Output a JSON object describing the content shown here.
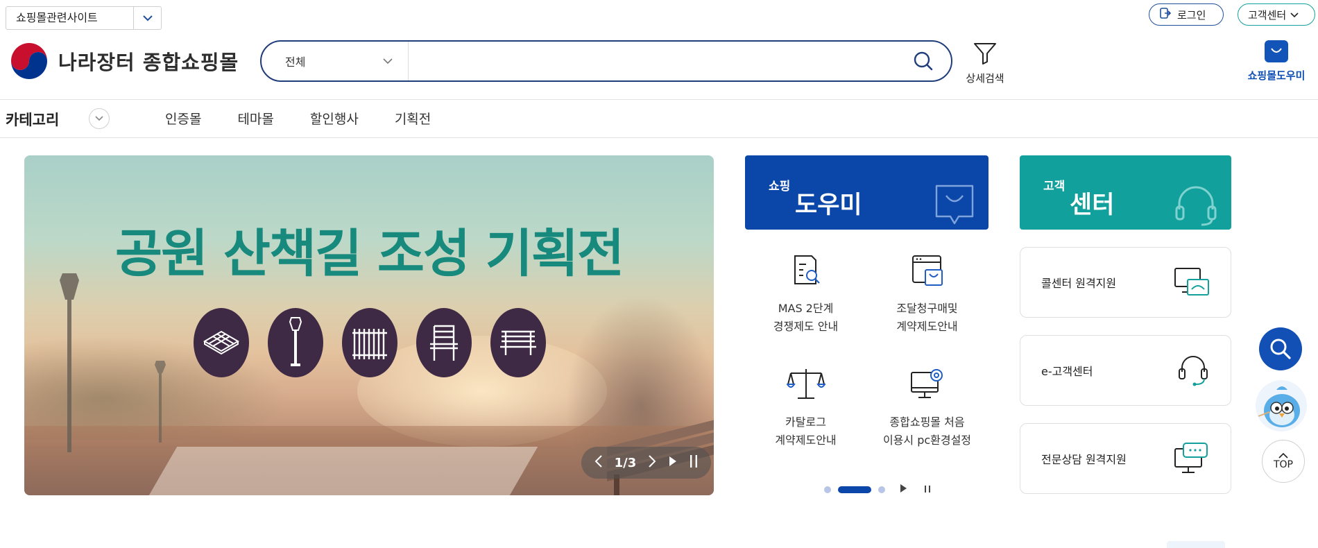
{
  "top_bar": {
    "site_select_label": "쇼핑몰관련사이트",
    "login_label": "로그인",
    "customer_center_label": "고객센터"
  },
  "header": {
    "logo_title": "나라장터 종합쇼핑몰",
    "search_scope": "전체",
    "search_value": "",
    "detail_search_label": "상세검색",
    "helper_label": "쇼핑몰도우미"
  },
  "nav": {
    "category_label": "카테고리",
    "items": [
      "인증몰",
      "테마몰",
      "할인행사",
      "기획전"
    ]
  },
  "banner": {
    "headline": "공원 산책길 조성 기획전",
    "pager": "1/3"
  },
  "shopping_helper": {
    "small_label": "쇼핑",
    "big_label": "도우미",
    "items": [
      {
        "line1": "MAS 2단계",
        "line2": "경쟁제도 안내",
        "icon": "document-search-icon"
      },
      {
        "line1": "조달청구매및",
        "line2": "계약제도안내",
        "icon": "browser-cart-icon"
      },
      {
        "line1": "카탈로그",
        "line2": "계약제도안내",
        "icon": "scale-icon"
      },
      {
        "line1": "종합쇼핑몰 처음",
        "line2": "이용시 pc환경설정",
        "icon": "monitor-gear-icon"
      }
    ]
  },
  "customer_center": {
    "small_label": "고객",
    "big_label": "센터",
    "cards": [
      {
        "label": "콜센터 원격지원",
        "icon": "remote-monitor-icon"
      },
      {
        "label": "e-고객센터",
        "icon": "headset-icon"
      },
      {
        "label": "전문상담 원격지원",
        "icon": "chat-monitor-icon"
      }
    ]
  },
  "floating": {
    "top_label": "TOP"
  },
  "colors": {
    "primary_blue": "#0b47a9",
    "teal": "#11a09c",
    "banner_text": "#17897d",
    "banner_icon_bg": "#3f2a45"
  }
}
